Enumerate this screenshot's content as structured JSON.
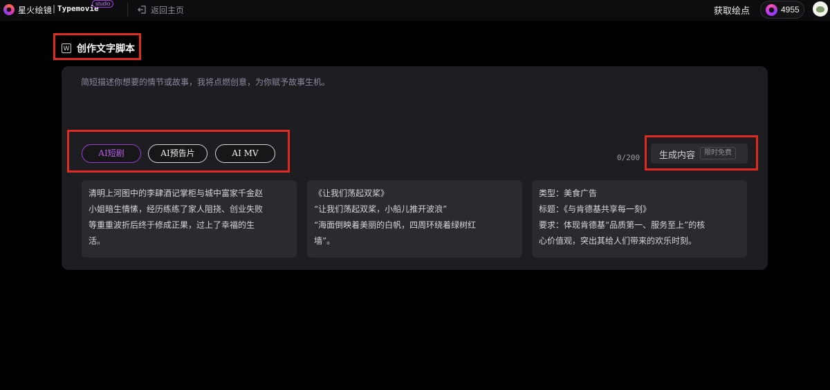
{
  "header": {
    "app_name": "星火绘镜",
    "separator": "|",
    "app_subtitle": "Typemovie",
    "studio_badge": "studio",
    "back_label": "返回主页",
    "get_points_label": "获取绘点",
    "points_value": "4955"
  },
  "section": {
    "title": "创作文字脚本",
    "title_icon_letter": "W"
  },
  "composer": {
    "placeholder": "简短描述你想要的情节或故事，我将点燃创意，为你赋予故事生机。",
    "types": [
      {
        "label": "AI短剧",
        "active": true
      },
      {
        "label": "AI预告片",
        "active": false
      },
      {
        "label": "AI MV",
        "active": false
      }
    ],
    "char_count": "0/200",
    "generate_label": "生成内容",
    "free_badge": "限时免费"
  },
  "examples": [
    {
      "lines": [
        "清明上河图中的李肆酒记掌柜与城中富家千金赵",
        "小姐暗生情愫，经历练练了家人阻挠、创业失败",
        "等重重波折后终于修成正果，过上了幸福的生",
        "活。"
      ]
    },
    {
      "lines": [
        "《让我们荡起双桨》",
        "“让我们荡起双桨，小船儿推开波浪”",
        "“海面倒映着美丽的白帆，四周环绕着绿树红",
        "墙”。"
      ]
    },
    {
      "lines": [
        "类型：美食广告",
        "标题：《与肯德基共享每一刻》",
        "要求：体现肯德基“品质第一、服务至上”的核",
        "心价值观，突出其给人们带来的欢乐时刻。"
      ]
    }
  ],
  "colors": {
    "accent_purple": "#9b3fd6",
    "highlight_red": "#e02b20",
    "panel_bg": "#1e1e22",
    "card_bg": "#2a2a2f"
  }
}
